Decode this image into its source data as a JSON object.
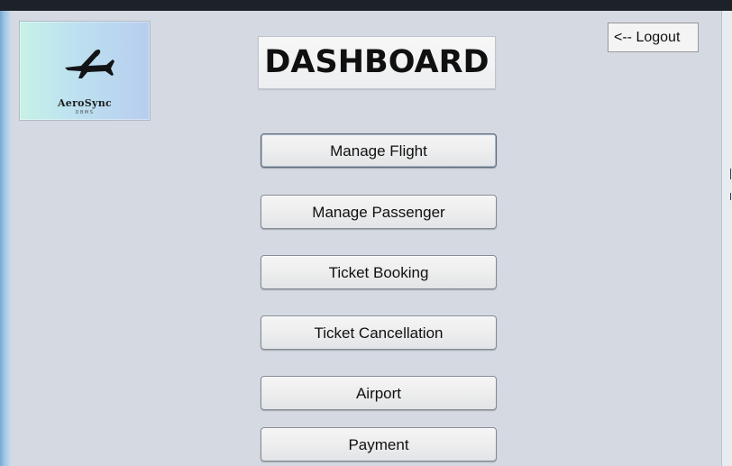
{
  "app": {
    "logo": {
      "icon": "airplane-icon",
      "name": "AeroSync",
      "subtitle": "DBMS"
    },
    "title": "DASHBOARD",
    "logout_label": "<-- Logout",
    "buttons": [
      "Manage Flight",
      "Manage Passenger",
      "Ticket Booking",
      "Ticket Cancellation",
      "Airport",
      "Payment"
    ]
  },
  "colors": {
    "window_background": "#d5d9e2",
    "outer_background": "#1d2229",
    "logo_gradient_start": "#c7f1e7",
    "logo_gradient_end": "#b8cdef"
  }
}
